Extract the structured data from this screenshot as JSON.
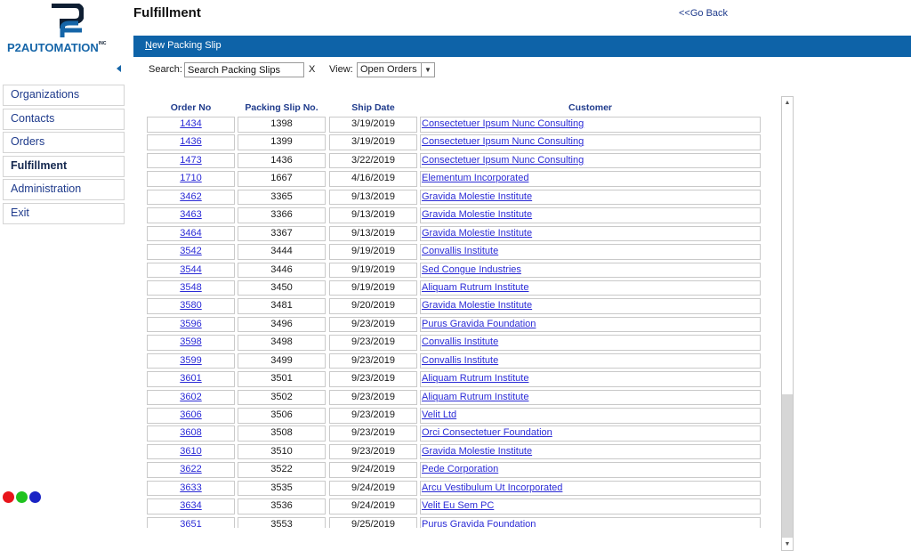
{
  "header": {
    "logo_text": "P2AUTOMATION",
    "logo_suffix": "INC",
    "title": "Fulfillment",
    "go_back": "<<Go Back"
  },
  "action_bar": {
    "new_packing_slip_first": "N",
    "new_packing_slip_rest": "ew Packing Slip"
  },
  "sidebar": {
    "items": [
      {
        "label": "Organizations"
      },
      {
        "label": "Contacts"
      },
      {
        "label": "Orders"
      },
      {
        "label": "Fulfillment"
      },
      {
        "label": "Administration"
      },
      {
        "label": "Exit"
      }
    ],
    "active_index": 3
  },
  "status_dots": [
    "#e8141b",
    "#1fc21f",
    "#1a23c4"
  ],
  "search": {
    "label": "Search:",
    "value": "Search Packing Slips",
    "clear": "X"
  },
  "view": {
    "label": "View:",
    "selected": "Open Orders"
  },
  "table": {
    "headers": [
      "Order No",
      "Packing Slip No.",
      "Ship Date",
      "Customer"
    ],
    "rows": [
      {
        "order": "1434",
        "slip": "1398",
        "date": "3/19/2019",
        "customer": "Consectetuer Ipsum Nunc Consulting"
      },
      {
        "order": "1436",
        "slip": "1399",
        "date": "3/19/2019",
        "customer": "Consectetuer Ipsum Nunc Consulting"
      },
      {
        "order": "1473",
        "slip": "1436",
        "date": "3/22/2019",
        "customer": "Consectetuer Ipsum Nunc Consulting"
      },
      {
        "order": "1710",
        "slip": "1667",
        "date": "4/16/2019",
        "customer": "Elementum Incorporated"
      },
      {
        "order": "3462",
        "slip": "3365",
        "date": "9/13/2019",
        "customer": "Gravida Molestie Institute"
      },
      {
        "order": "3463",
        "slip": "3366",
        "date": "9/13/2019",
        "customer": "Gravida Molestie Institute"
      },
      {
        "order": "3464",
        "slip": "3367",
        "date": "9/13/2019",
        "customer": "Gravida Molestie Institute"
      },
      {
        "order": "3542",
        "slip": "3444",
        "date": "9/19/2019",
        "customer": "Convallis Institute"
      },
      {
        "order": "3544",
        "slip": "3446",
        "date": "9/19/2019",
        "customer": "Sed Congue Industries"
      },
      {
        "order": "3548",
        "slip": "3450",
        "date": "9/19/2019",
        "customer": "Aliquam Rutrum Institute"
      },
      {
        "order": "3580",
        "slip": "3481",
        "date": "9/20/2019",
        "customer": "Gravida Molestie Institute"
      },
      {
        "order": "3596",
        "slip": "3496",
        "date": "9/23/2019",
        "customer": "Purus Gravida Foundation"
      },
      {
        "order": "3598",
        "slip": "3498",
        "date": "9/23/2019",
        "customer": "Convallis Institute"
      },
      {
        "order": "3599",
        "slip": "3499",
        "date": "9/23/2019",
        "customer": "Convallis Institute"
      },
      {
        "order": "3601",
        "slip": "3501",
        "date": "9/23/2019",
        "customer": "Aliquam Rutrum Institute"
      },
      {
        "order": "3602",
        "slip": "3502",
        "date": "9/23/2019",
        "customer": "Aliquam Rutrum Institute"
      },
      {
        "order": "3606",
        "slip": "3506",
        "date": "9/23/2019",
        "customer": "Velit Ltd"
      },
      {
        "order": "3608",
        "slip": "3508",
        "date": "9/23/2019",
        "customer": "Orci Consectetuer Foundation"
      },
      {
        "order": "3610",
        "slip": "3510",
        "date": "9/23/2019",
        "customer": "Gravida Molestie Institute"
      },
      {
        "order": "3622",
        "slip": "3522",
        "date": "9/24/2019",
        "customer": "Pede Corporation"
      },
      {
        "order": "3633",
        "slip": "3535",
        "date": "9/24/2019",
        "customer": "Arcu Vestibulum Ut Incorporated"
      },
      {
        "order": "3634",
        "slip": "3536",
        "date": "9/24/2019",
        "customer": "Velit Eu Sem PC"
      },
      {
        "order": "3651",
        "slip": "3553",
        "date": "9/25/2019",
        "customer": "Purus Gravida Foundation"
      }
    ]
  },
  "colors": {
    "brand_blue": "#0e63a8",
    "link_blue": "#2b2bd6",
    "nav_text": "#1f3b8c"
  },
  "icons": {
    "collapse": "chevron-left-icon",
    "select_caret": "chevron-down-icon",
    "scroll_up": "arrow-up-icon",
    "scroll_down": "arrow-down-icon"
  }
}
